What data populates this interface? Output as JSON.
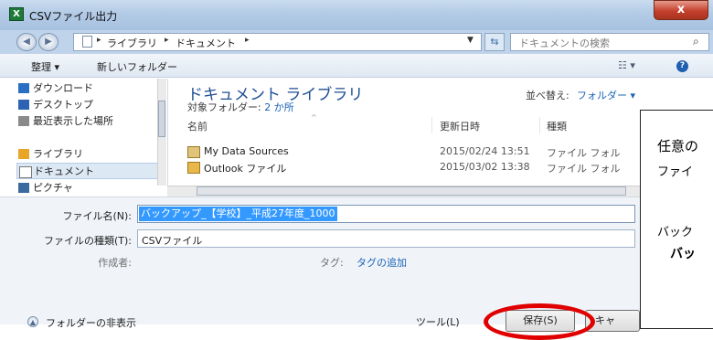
{
  "window": {
    "title": "CSVファイル出力",
    "app_icon": "X",
    "close": "x"
  },
  "address": {
    "crumbs": [
      "ライブラリ",
      "ドキュメント"
    ],
    "search_placeholder": "ドキュメントの検索"
  },
  "toolbar": {
    "organize": "整理 ▾",
    "new_folder": "新しいフォルダー"
  },
  "nav_pane": {
    "items": [
      {
        "label": "ダウンロード",
        "icon": "download-folder-icon",
        "color": "#2b6fc4"
      },
      {
        "label": "デスクトップ",
        "icon": "desktop-icon",
        "color": "#2c63b5"
      },
      {
        "label": "最近表示した場所",
        "icon": "recent-places-icon",
        "color": "#8a8a8a"
      },
      {
        "label": "ライブラリ",
        "icon": "libraries-icon",
        "color": "#e8a628"
      },
      {
        "label": "ドキュメント",
        "icon": "documents-icon",
        "color": "#ffffff",
        "selected": true
      },
      {
        "label": "ピクチャ",
        "icon": "pictures-icon",
        "color": "#3b6aa0"
      }
    ]
  },
  "content": {
    "library_title": "ドキュメント ライブラリ",
    "subtitle_prefix": "対象フォルダー:",
    "subtitle_link": "2 か所",
    "sort_label": "並べ替え:",
    "sort_value": "フォルダー ▾",
    "columns": {
      "name": "名前",
      "date": "更新日時",
      "type": "種類"
    },
    "rows": [
      {
        "name": "My Data Sources",
        "date": "2015/02/24 13:51",
        "type": "ファイル フォル"
      },
      {
        "name": "Outlook ファイル",
        "date": "2015/03/02 13:38",
        "type": "ファイル フォル"
      }
    ]
  },
  "form": {
    "filename_label": "ファイル名(N):",
    "filename_value": "バックアップ_【学校】_平成27年度_1000",
    "filetype_label": "ファイルの種類(T):",
    "filetype_value": "CSVファイル",
    "author_label": "作成者:",
    "tag_label": "タグ:",
    "tag_link": "タグの追加"
  },
  "bottom": {
    "hide_folders": "フォルダーの非表示",
    "tools": "ツール(L)",
    "save": "保存(S)",
    "cancel": "キャ"
  },
  "callout": {
    "line1": "任意の",
    "line2": "ファイ",
    "line3": "バック",
    "line4": "バッ"
  },
  "colors": {
    "highlight": "#e00000",
    "selection": "#3399ff",
    "link": "#1a63b5"
  }
}
